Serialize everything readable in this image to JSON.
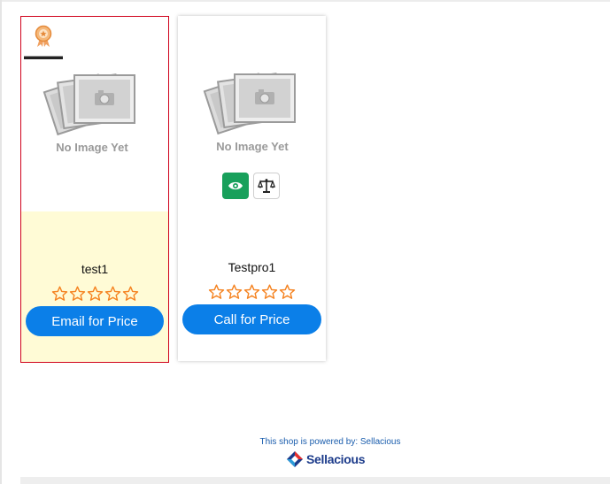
{
  "products": [
    {
      "name": "test1",
      "price_action": "Email for Price",
      "image_placeholder": "No Image Yet",
      "rating": 0,
      "rating_max": 5,
      "featured_badge_icon": "award-ribbon-icon"
    },
    {
      "name": "Testpro1",
      "price_action": "Call for Price",
      "image_placeholder": "No Image Yet",
      "rating": 0,
      "rating_max": 5,
      "quick_view_icon": "eye-icon",
      "compare_icon": "balance-scale-icon"
    }
  ],
  "footer": {
    "powered_by": "This shop is powered by: Sellacious",
    "brand_name": "Sellacious",
    "brand_icon": "sellacious-logo-icon"
  },
  "colors": {
    "button_blue": "#0b7fe8",
    "quick_view_green": "#18a05b",
    "star_orange": "#f5821f",
    "selected_border": "#d0021b",
    "selected_bg": "#fffbd6"
  }
}
